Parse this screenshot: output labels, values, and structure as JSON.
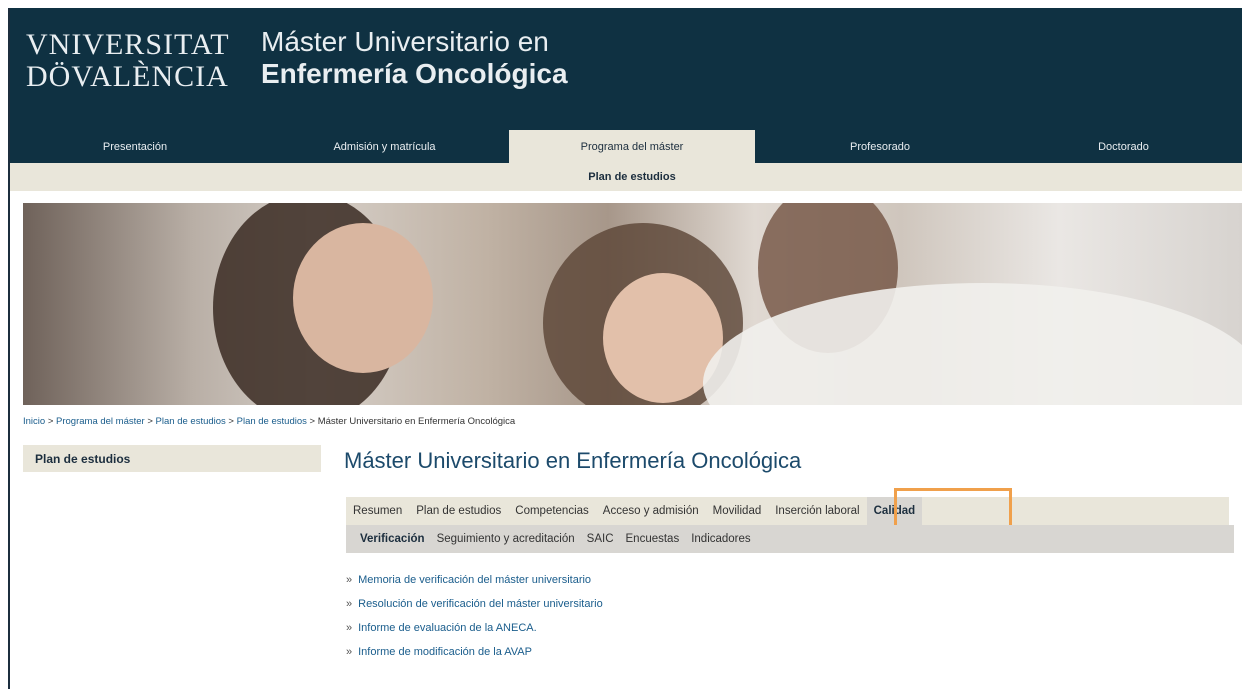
{
  "header": {
    "logo_line1": "VNIVERSITAT",
    "logo_line2": "DÖVALÈNCIA",
    "title_line1": "Máster Universitario en",
    "title_line2": "Enfermería Oncológica"
  },
  "mainnav": [
    {
      "label": "Presentación"
    },
    {
      "label": "Admisión y matrícula"
    },
    {
      "label": "Programa del máster"
    },
    {
      "label": "Profesorado"
    },
    {
      "label": "Doctorado"
    }
  ],
  "subnav": {
    "label": "Plan de estudios"
  },
  "breadcrumb": {
    "items": [
      "Inicio",
      "Programa del máster",
      "Plan de estudios",
      "Plan de estudios"
    ],
    "separator": " > ",
    "current": "Máster Universitario en Enfermería Oncológica"
  },
  "sidebar": {
    "title": "Plan de estudios"
  },
  "content": {
    "title": "Máster Universitario en Enfermería Oncológica",
    "tabs": [
      {
        "label": "Resumen"
      },
      {
        "label": "Plan de estudios"
      },
      {
        "label": "Competencias"
      },
      {
        "label": "Acceso y admisión"
      },
      {
        "label": "Movilidad"
      },
      {
        "label": "Inserción laboral"
      },
      {
        "label": "Calidad"
      }
    ],
    "subtabs": [
      {
        "label": "Verificación"
      },
      {
        "label": "Seguimiento y acreditación"
      },
      {
        "label": "SAIC"
      },
      {
        "label": "Encuestas"
      },
      {
        "label": "Indicadores"
      }
    ],
    "bullet": "»",
    "links": [
      {
        "label": "Memoria de verificación del máster universitario"
      },
      {
        "label": "Resolución de verificación del máster universitario"
      },
      {
        "label": "Informe de evaluación de la ANECA."
      },
      {
        "label": "Informe de modificación de la AVAP"
      }
    ]
  },
  "colors": {
    "header_bg": "#0f3142",
    "nav_active_bg": "#e9e6da",
    "link": "#1a5d8c",
    "highlight": "#f0a04b"
  }
}
